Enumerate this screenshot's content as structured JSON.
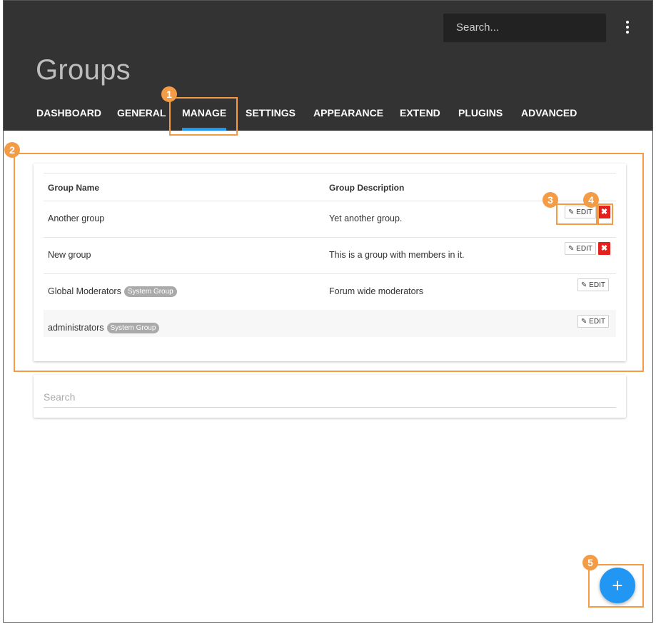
{
  "header": {
    "search_placeholder": "Search...",
    "title": "Groups",
    "nav": [
      "DASHBOARD",
      "GENERAL",
      "MANAGE",
      "SETTINGS",
      "APPEARANCE",
      "EXTEND",
      "PLUGINS",
      "ADVANCED"
    ],
    "active_nav": "MANAGE"
  },
  "table": {
    "columns": [
      "Group Name",
      "Group Description"
    ],
    "rows": [
      {
        "name": "Another group",
        "badge": "",
        "description": "Yet another group.",
        "edit": "EDIT",
        "deletable": true
      },
      {
        "name": "New group",
        "badge": "",
        "description": "This is a group with members in it.",
        "edit": "EDIT",
        "deletable": true
      },
      {
        "name": "Global Moderators",
        "badge": "System Group",
        "description": "Forum wide moderators",
        "edit": "EDIT",
        "deletable": false
      },
      {
        "name": "administrators",
        "badge": "System Group",
        "description": "",
        "edit": "EDIT",
        "deletable": false
      }
    ]
  },
  "filter": {
    "placeholder": "Search"
  },
  "fab": {
    "label": "+"
  },
  "callouts": [
    "1",
    "2",
    "3",
    "4",
    "5"
  ],
  "colors": {
    "header_bg": "#333333",
    "accent": "#2196f3",
    "callout": "#f39c45",
    "delete": "#e3201b"
  }
}
